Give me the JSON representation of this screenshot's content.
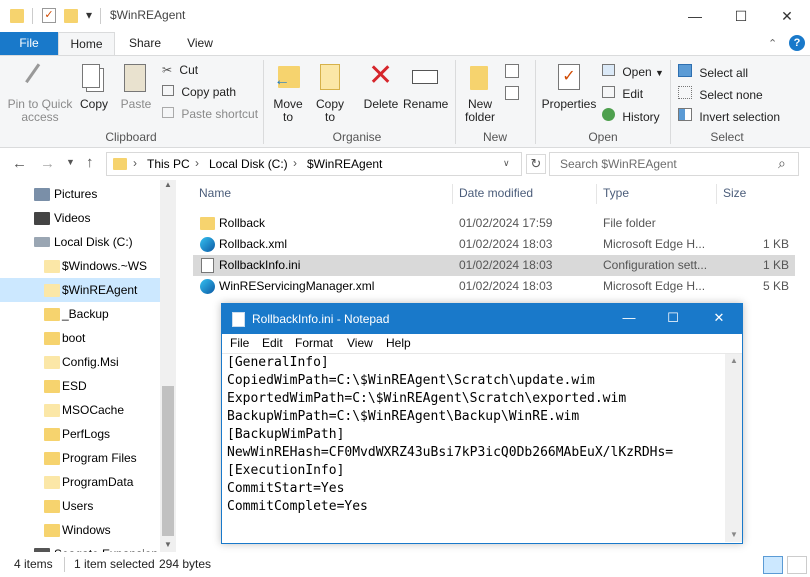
{
  "window": {
    "title": "$WinREAgent",
    "qat_dropdown": "▾",
    "minimize": "—",
    "maximize": "☐",
    "close": "✕"
  },
  "tabs": [
    {
      "label": "File"
    },
    {
      "label": "Home"
    },
    {
      "label": "Share"
    },
    {
      "label": "View"
    }
  ],
  "ribbon": {
    "clipboard": {
      "pin_l1": "Pin to Quick",
      "pin_l2": "access",
      "copy": "Copy",
      "paste": "Paste",
      "cut": "Cut",
      "copy_path": "Copy path",
      "paste_shortcut": "Paste shortcut",
      "group": "Clipboard"
    },
    "organise": {
      "move_l1": "Move",
      "move_l2": "to",
      "copy_l1": "Copy",
      "copy_l2": "to",
      "delete": "Delete",
      "rename": "Rename",
      "group": "Organise"
    },
    "new": {
      "folder_l1": "New",
      "folder_l2": "folder",
      "group": "New"
    },
    "open": {
      "properties": "Properties",
      "open": "Open",
      "edit": "Edit",
      "history": "History",
      "group": "Open"
    },
    "select": {
      "all": "Select all",
      "none": "Select none",
      "invert": "Invert selection",
      "group": "Select"
    }
  },
  "address": {
    "segments": [
      "This PC",
      "Local Disk (C:)",
      "$WinREAgent"
    ],
    "search_placeholder": "Search $WinREAgent"
  },
  "nav": [
    {
      "label": "Pictures"
    },
    {
      "label": "Videos"
    },
    {
      "label": "Local Disk (C:)"
    },
    {
      "label": "$Windows.~WS"
    },
    {
      "label": "$WinREAgent"
    },
    {
      "label": "_Backup"
    },
    {
      "label": "boot"
    },
    {
      "label": "Config.Msi"
    },
    {
      "label": "ESD"
    },
    {
      "label": "MSOCache"
    },
    {
      "label": "PerfLogs"
    },
    {
      "label": "Program Files"
    },
    {
      "label": "ProgramData"
    },
    {
      "label": "Users"
    },
    {
      "label": "Windows"
    },
    {
      "label": "Seagate Expansion D"
    }
  ],
  "columns": {
    "name": "Name",
    "date": "Date modified",
    "type": "Type",
    "size": "Size"
  },
  "files": [
    {
      "name": "Rollback",
      "date": "01/02/2024 17:59",
      "type": "File folder",
      "size": ""
    },
    {
      "name": "Rollback.xml",
      "date": "01/02/2024 18:03",
      "type": "Microsoft Edge H...",
      "size": "1 KB"
    },
    {
      "name": "RollbackInfo.ini",
      "date": "01/02/2024 18:03",
      "type": "Configuration sett...",
      "size": "1 KB"
    },
    {
      "name": "WinREServicingManager.xml",
      "date": "01/02/2024 18:03",
      "type": "Microsoft Edge H...",
      "size": "5 KB"
    }
  ],
  "status": {
    "items": "4 items",
    "selected": "1 item selected",
    "bytes": "294 bytes"
  },
  "notepad": {
    "title": "RollbackInfo.ini - Notepad",
    "menu": [
      "File",
      "Edit",
      "Format",
      "View",
      "Help"
    ],
    "lines": [
      "[GeneralInfo]",
      "CopiedWimPath=C:\\$WinREAgent\\Scratch\\update.wim",
      "ExportedWimPath=C:\\$WinREAgent\\Scratch\\exported.wim",
      "BackupWimPath=C:\\$WinREAgent\\Backup\\WinRE.wim",
      "[BackupWimPath]",
      "NewWinREHash=CF0MvdWXRZ43uBsi7kP3icQ0Db266MAbEuX/lKzRDHs=",
      "[ExecutionInfo]",
      "CommitStart=Yes",
      "CommitComplete=Yes"
    ]
  },
  "colors": {
    "accent": "#1979ca",
    "selection": "#cce8ff",
    "folder": "#f6d36e"
  }
}
